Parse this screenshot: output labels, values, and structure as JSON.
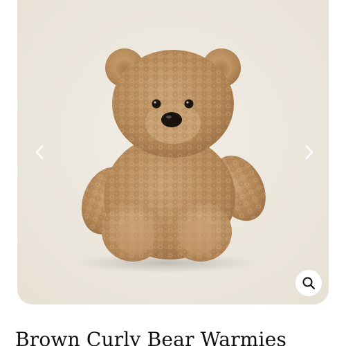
{
  "product": {
    "title": "Brown Curly Bear Warmies"
  },
  "gallery": {
    "image_subject": "brown curly teddy bear plush",
    "prev_icon": "chevron-left-icon",
    "next_icon": "chevron-right-icon",
    "zoom_icon": "magnifier-icon"
  },
  "colors": {
    "gallery_background": "#eee9df",
    "bear_fur": "#b88d5f",
    "title_text": "#111111"
  }
}
